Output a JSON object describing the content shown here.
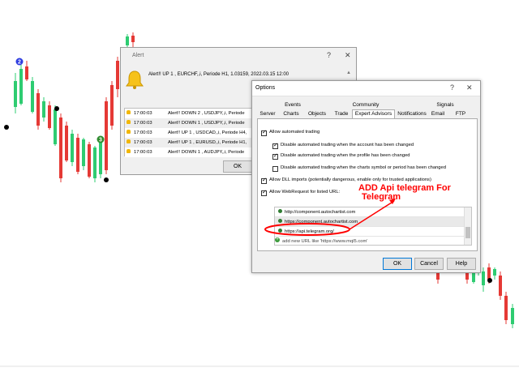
{
  "alert": {
    "title": "Alert",
    "question_btn": "?",
    "close_btn": "✕",
    "main_message": "Alert!! UP 1 , EURCHF,,i, Periode H1, 1.03159, 2022.03.15 12:00",
    "rows": [
      {
        "time": "17:00:03",
        "message": "Alert!! DOWN 2 , USDJPY,,i, Periode"
      },
      {
        "time": "17:00:03",
        "message": "Alert!! DOWN 1 , USDJPY,,i, Periode"
      },
      {
        "time": "17:00:03",
        "message": "Alert!! UP 1 , USDCAD,,i, Periode H4,"
      },
      {
        "time": "17:00:03",
        "message": "Alert!! UP 1 , EURUSD,,i, Periode H1,"
      },
      {
        "time": "17:00:03",
        "message": "Alert!! DOWN 1 , AUDJPY,,i, Periode"
      }
    ],
    "ok_label": "OK"
  },
  "options": {
    "title": "Options",
    "question_btn": "?",
    "close_btn": "✕",
    "tabs_top": [
      "Events",
      "Community",
      "Signals"
    ],
    "tabs_bottom": [
      "Server",
      "Charts",
      "Objects",
      "Trade",
      "Expert Advisors",
      "Notifications",
      "Email",
      "FTP"
    ],
    "active_tab": "Expert Advisors",
    "checkboxes": [
      {
        "label": "Allow automated trading",
        "checked": true
      },
      {
        "label": "Disable automated trading when the account has been changed",
        "checked": true
      },
      {
        "label": "Disable automated trading when the profile has been changed",
        "checked": true
      },
      {
        "label": "Disable automated trading when the charts symbol or period has been changed",
        "checked": false
      },
      {
        "label": "Allow DLL imports (potentially dangerous, enable only for trusted applications)",
        "checked": true
      },
      {
        "label": "Allow WebRequest for listed URL:",
        "checked": true
      }
    ],
    "urls": [
      "http://component.autochartist.com",
      "https://component.autochartist.com",
      "https://api.telegram.org/"
    ],
    "add_url": "add new URL like 'https://www.mql5.com'",
    "ok_label": "OK",
    "cancel_label": "Cancel",
    "help_label": "Help"
  },
  "annotation": {
    "line1": "ADD Api telegram For",
    "line2": "Telegram",
    "color": "#ff0000"
  },
  "chart": {
    "bull_color": "#2ecc71",
    "bear_color": "#e53935",
    "markers": [
      {
        "label": "2",
        "color": "#2d3ce0"
      },
      {
        "label": "3",
        "color": "#2e8b2e"
      }
    ]
  }
}
